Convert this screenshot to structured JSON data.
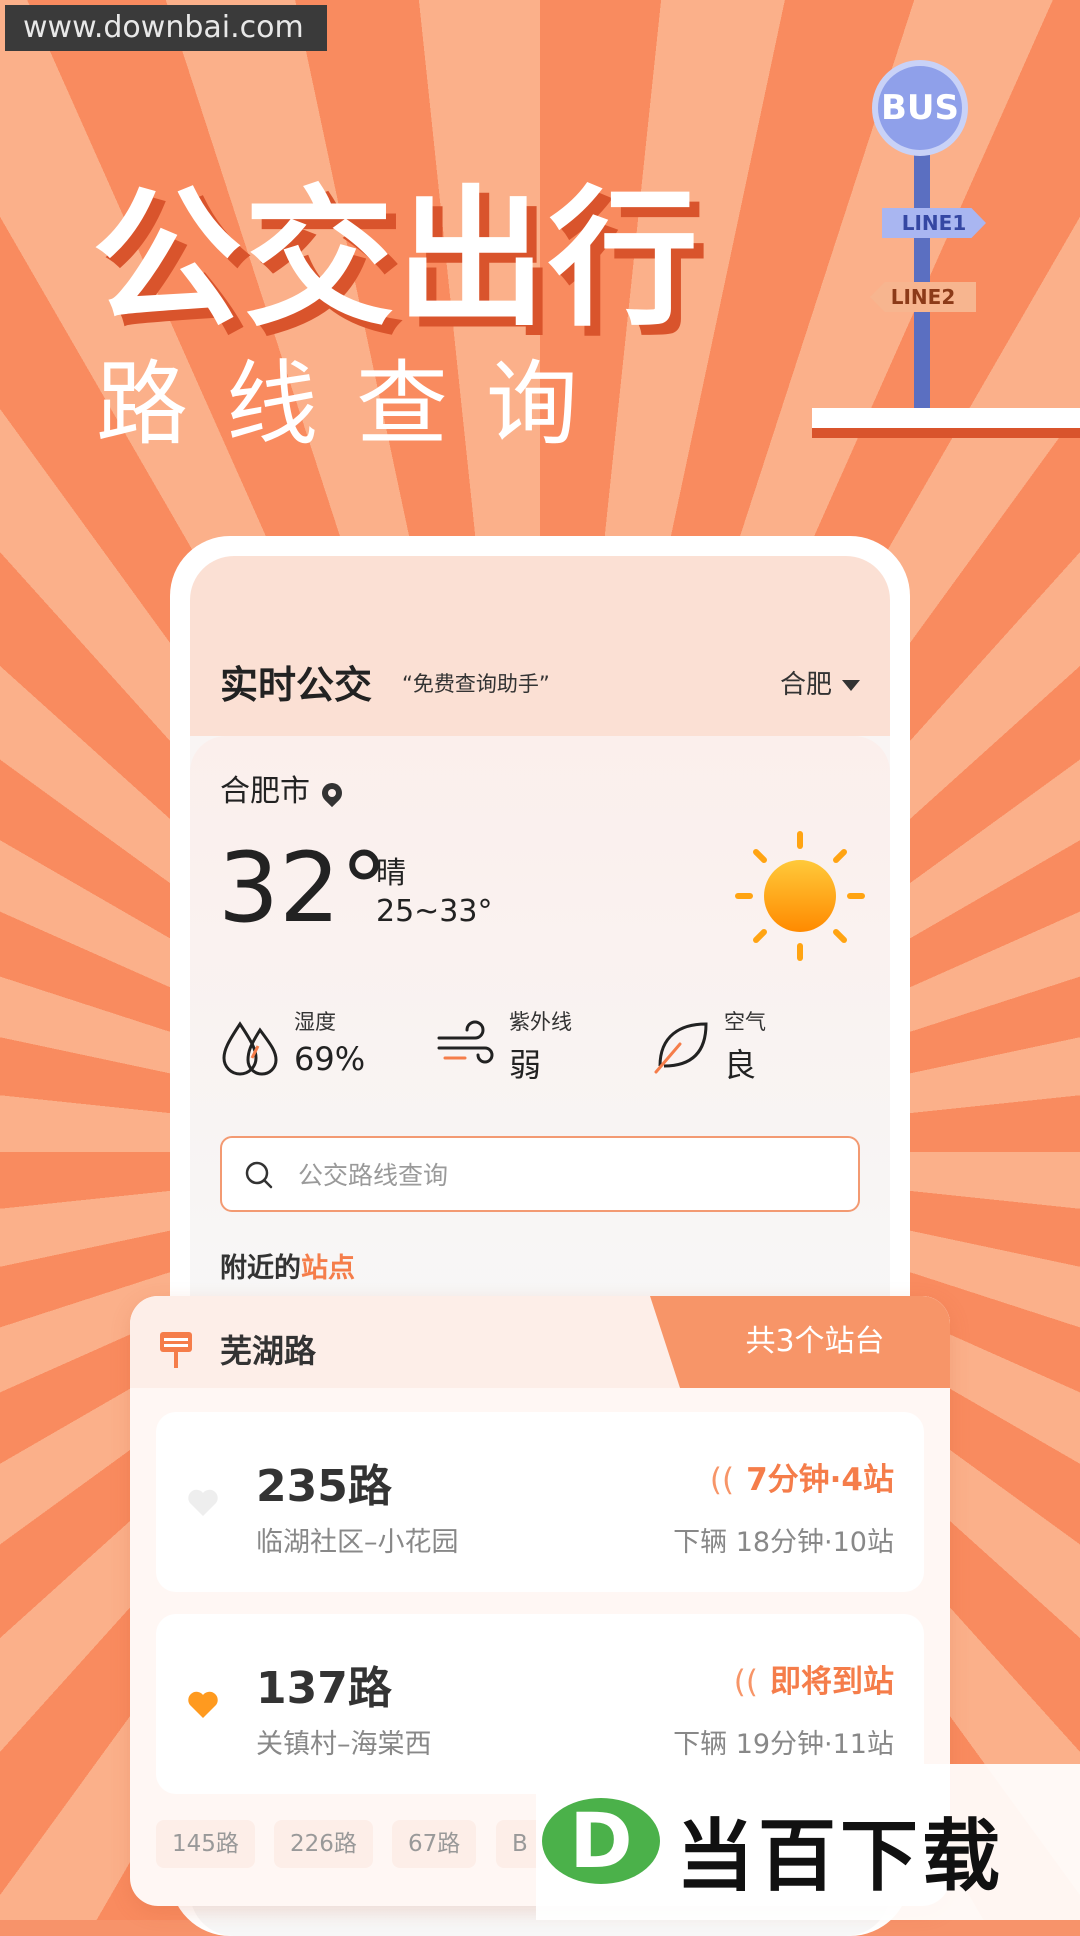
{
  "watermark_top": "www.downbai.com",
  "hero": {
    "title": "公交出行",
    "subtitle": "路线查询"
  },
  "sign": {
    "bus": "BUS",
    "line1": "LINE1",
    "line2": "LINE2"
  },
  "app": {
    "title": "实时公交",
    "slogan": "“免费查询助手”",
    "city": "合肥"
  },
  "weather": {
    "location": "合肥市",
    "temp": "32°",
    "desc": "晴",
    "range": "25~33°",
    "stats": [
      {
        "label": "湿度",
        "value": "69%",
        "icon": "humidity-icon"
      },
      {
        "label": "紫外线",
        "value": "弱",
        "icon": "wind-icon"
      },
      {
        "label": "空气",
        "value": "良",
        "icon": "leaf-icon"
      }
    ]
  },
  "search": {
    "placeholder": "公交路线查询"
  },
  "nearby": {
    "prefix": "附近的",
    "highlight": "站点"
  },
  "station": {
    "name": "芜湖路",
    "platforms": "共3个站台",
    "routes": [
      {
        "num": "235路",
        "path": "临湖社区–小花园",
        "eta": "7分钟·4站",
        "next": "下辆 18分钟·10站",
        "favorite": false
      },
      {
        "num": "137路",
        "path": "关镇村–海棠西",
        "eta": "即将到站",
        "next": "下辆 19分钟·11站",
        "favorite": true
      }
    ],
    "chips": [
      "145路",
      "226路",
      "67路",
      "B"
    ]
  },
  "logo_watermark": {
    "badge": "D",
    "text": "当百下载"
  },
  "colors": {
    "accent": "#f57d4a",
    "favorite": "#ff9a1f",
    "sun": "#ffa412"
  }
}
